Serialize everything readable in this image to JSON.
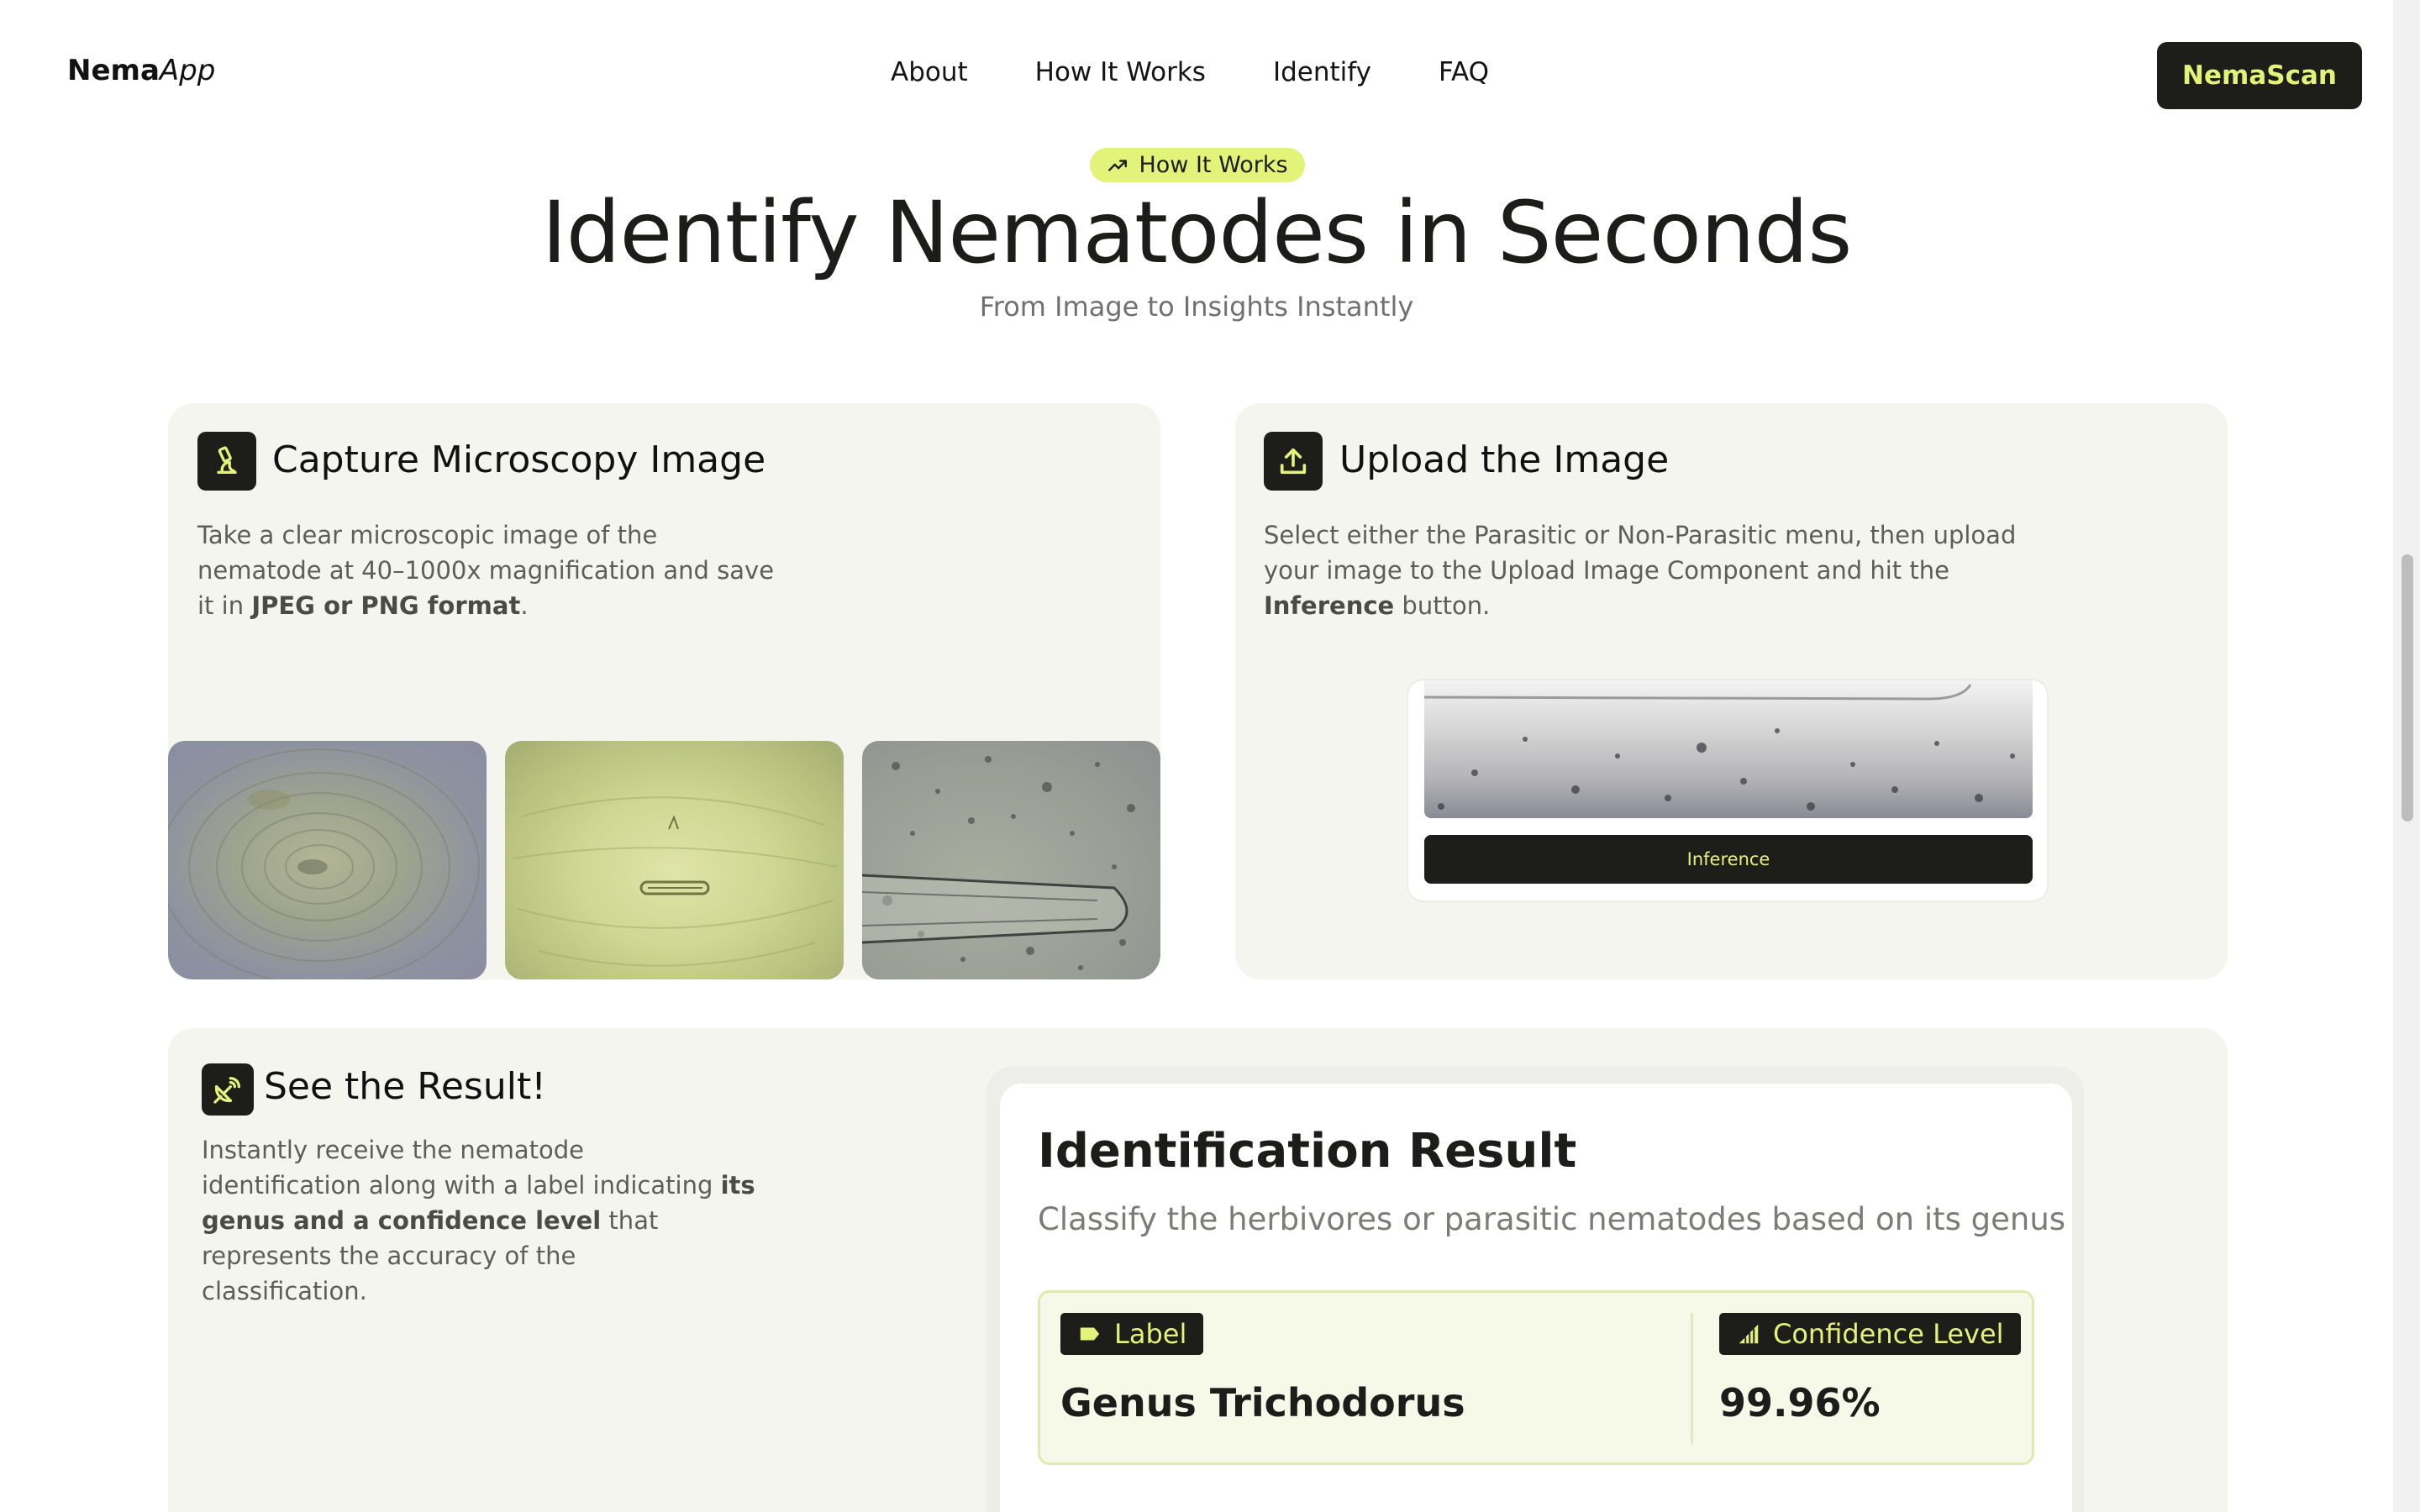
{
  "nav": {
    "logo_main": "Nema",
    "logo_italic": "App",
    "links": [
      "About",
      "How It Works",
      "Identify",
      "FAQ"
    ],
    "cta_label": "NemaScan"
  },
  "hero": {
    "pill_label": "How It Works",
    "pill_icon": "trend-icon",
    "title": "Identify Nematodes in Seconds",
    "subtitle": "From Image to Insights Instantly"
  },
  "steps": [
    {
      "icon": "microscope-icon",
      "title": "Capture Microscopy Image",
      "desc_1": "Take a clear microscopic image of the",
      "desc_2": "nematode at 40–1000x magnification and save",
      "desc_3_pre": "it in ",
      "desc_3_bold": "JPEG or PNG format",
      "desc_3_post": "."
    },
    {
      "icon": "upload-icon",
      "title": "Upload the Image",
      "desc_1": "Select either the Parasitic or Non-Parasitic menu, then upload",
      "desc_2": "your image to the Upload Image Component and hit the",
      "desc_3_bold": "Inference",
      "desc_3_post": " button.",
      "button_label": "Inference"
    },
    {
      "icon": "satellite-dish-icon",
      "title": "See the Result!",
      "desc_1": "Instantly receive the nematode",
      "desc_2_pre": "identification along with a label indicating ",
      "desc_2_bold": "its",
      "desc_3_bold": "genus and a confidence level",
      "desc_3_post": " that",
      "desc_4": "represents the accuracy of the",
      "desc_5": "classification."
    }
  ],
  "result": {
    "title": "Identification Result",
    "subtitle": "Classify the herbivores or parasitic nematodes based on its genus",
    "label_tag": "Label",
    "confidence_tag": "Confidence Level",
    "label_value": "Genus Trichodorus",
    "confidence_value": "99.96%"
  },
  "colors": {
    "accent": "#e3f27a",
    "dark": "#1d1e19",
    "card_bg": "#f5f5f0"
  }
}
